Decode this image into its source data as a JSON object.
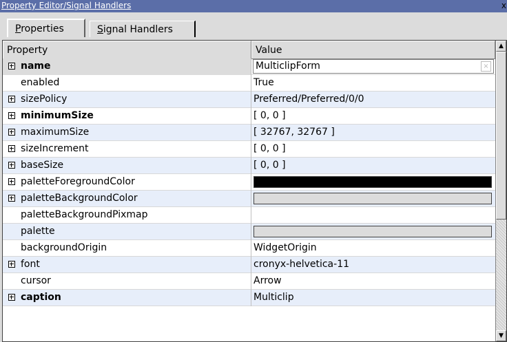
{
  "window": {
    "title": "Property Editor/Signal Handlers",
    "close_glyph": "x"
  },
  "tabs": [
    {
      "label": "Properties",
      "mnemonic": "P",
      "rest": "roperties"
    },
    {
      "label": "Signal Handlers",
      "mnemonic": "S",
      "rest": "ignal Handlers"
    }
  ],
  "table": {
    "headers": {
      "property": "Property",
      "value": "Value"
    },
    "rows": [
      {
        "name": "name",
        "value": "MulticlipForm",
        "expandable": true,
        "bold": true,
        "editing": true
      },
      {
        "name": "enabled",
        "value": "True",
        "expandable": false,
        "bold": false
      },
      {
        "name": "sizePolicy",
        "value": "Preferred/Preferred/0/0",
        "expandable": true,
        "bold": false
      },
      {
        "name": "minimumSize",
        "value": "[ 0, 0 ]",
        "expandable": true,
        "bold": true
      },
      {
        "name": "maximumSize",
        "value": "[ 32767, 32767 ]",
        "expandable": true,
        "bold": false
      },
      {
        "name": "sizeIncrement",
        "value": "[ 0, 0 ]",
        "expandable": true,
        "bold": false
      },
      {
        "name": "baseSize",
        "value": "[ 0, 0 ]",
        "expandable": true,
        "bold": false
      },
      {
        "name": "paletteForegroundColor",
        "value": "",
        "swatch": "#000000",
        "expandable": true,
        "bold": false
      },
      {
        "name": "paletteBackgroundColor",
        "value": "",
        "swatch": "#dcdcdc",
        "expandable": true,
        "bold": false
      },
      {
        "name": "paletteBackgroundPixmap",
        "value": "",
        "expandable": false,
        "bold": false
      },
      {
        "name": "palette",
        "value": "",
        "swatch": "#dcdcdc",
        "expandable": false,
        "bold": false
      },
      {
        "name": "backgroundOrigin",
        "value": "WidgetOrigin",
        "expandable": false,
        "bold": false
      },
      {
        "name": "font",
        "value": "cronyx-helvetica-11",
        "expandable": true,
        "bold": false
      },
      {
        "name": "cursor",
        "value": "Arrow",
        "expandable": false,
        "bold": false
      },
      {
        "name": "caption",
        "value": "Multiclip",
        "expandable": true,
        "bold": true
      }
    ]
  }
}
